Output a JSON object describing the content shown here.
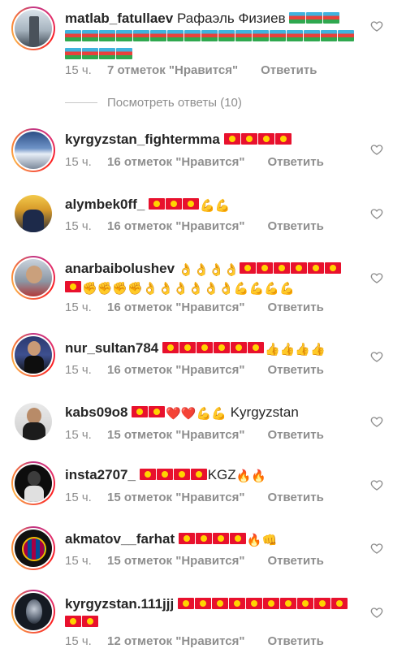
{
  "comments": [
    {
      "username": "matlab_fatullaev",
      "text_pre": "Рафаэль Физиев",
      "time": "15 ч.",
      "likes": "7 отметок \"Нравится\"",
      "reply": "Ответить"
    },
    {
      "username": "kyrgyzstan_fightermma",
      "time": "15 ч.",
      "likes": "16 отметок \"Нравится\"",
      "reply": "Ответить"
    },
    {
      "username": "alymbek0ff_",
      "time": "15 ч.",
      "likes": "16 отметок \"Нравится\"",
      "reply": "Ответить"
    },
    {
      "username": "anarbaibolushev",
      "time": "15 ч.",
      "likes": "16 отметок \"Нравится\"",
      "reply": "Ответить"
    },
    {
      "username": "nur_sultan784",
      "time": "15 ч.",
      "likes": "16 отметок \"Нравится\"",
      "reply": "Ответить"
    },
    {
      "username": "kabs09o8",
      "text_post": "Kyrgyzstan",
      "time": "15 ч.",
      "likes": "15 отметок \"Нравится\"",
      "reply": "Ответить"
    },
    {
      "username": "insta2707_",
      "text_post": "KGZ",
      "time": "15 ч.",
      "likes": "15 отметок \"Нравится\"",
      "reply": "Ответить"
    },
    {
      "username": "akmatov__farhat",
      "time": "15 ч.",
      "likes": "15 отметок \"Нравится\"",
      "reply": "Ответить"
    },
    {
      "username": "kyrgyzstan.111jjj",
      "time": "15 ч.",
      "likes": "12 отметок \"Нравится\"",
      "reply": "Ответить"
    }
  ],
  "view_replies": "Посмотреть ответы (10)",
  "emoji": {
    "flex": "💪",
    "ok": "👌",
    "heart": "❤️",
    "thumbs": "👍",
    "fist": "✊",
    "fire": "🔥",
    "punch": "👊"
  },
  "colors": {
    "text": "#262626",
    "meta": "#8e8e8e",
    "az_blue": "#3fb3dd",
    "az_red": "#e8413b",
    "az_green": "#2fa84f",
    "kg_red": "#e8112d",
    "kg_sun": "#ffd400"
  },
  "icons": {
    "like": "heart-outline-icon",
    "flag_az": "azerbaijan-flag-icon",
    "flag_kg": "kyrgyzstan-flag-icon"
  }
}
